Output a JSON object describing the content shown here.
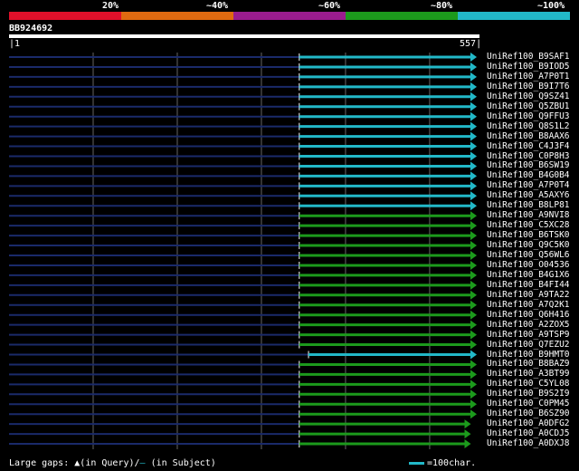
{
  "legend": {
    "segments": [
      {
        "label": "20%",
        "color": "#e0102a"
      },
      {
        "label": "~40%",
        "color": "#e06a10"
      },
      {
        "label": "~60%",
        "color": "#9a1c8e"
      },
      {
        "label": "~80%",
        "color": "#1c9a1c"
      },
      {
        "label": "~100%",
        "color": "#22b8c8"
      }
    ]
  },
  "query": {
    "id": "BB924692",
    "start": "1",
    "end": "557",
    "length": 557
  },
  "colors": {
    "gap_line": "#1a2a6a",
    "grid": "#666666",
    "hit_bar": "#ffffff"
  },
  "hits": [
    {
      "name": "UniRef100_B9SAF1",
      "from": 346,
      "to": 557,
      "color": "#22b8c8"
    },
    {
      "name": "UniRef100_B9IOD5",
      "from": 346,
      "to": 557,
      "color": "#22b8c8"
    },
    {
      "name": "UniRef100_A7P0T1",
      "from": 346,
      "to": 557,
      "color": "#22b8c8"
    },
    {
      "name": "UniRef100_B9I7T6",
      "from": 346,
      "to": 557,
      "color": "#22b8c8"
    },
    {
      "name": "UniRef100_Q9SZ41",
      "from": 346,
      "to": 557,
      "color": "#22b8c8"
    },
    {
      "name": "UniRef100_Q5ZBU1",
      "from": 346,
      "to": 557,
      "color": "#22b8c8"
    },
    {
      "name": "UniRef100_Q9FFU3",
      "from": 346,
      "to": 557,
      "color": "#22b8c8"
    },
    {
      "name": "UniRef100_Q8S1L2",
      "from": 346,
      "to": 557,
      "color": "#22b8c8"
    },
    {
      "name": "UniRef100_B8AAX6",
      "from": 346,
      "to": 557,
      "color": "#22b8c8"
    },
    {
      "name": "UniRef100_C4J3F4",
      "from": 346,
      "to": 557,
      "color": "#22b8c8"
    },
    {
      "name": "UniRef100_C0P8H3",
      "from": 346,
      "to": 557,
      "color": "#22b8c8"
    },
    {
      "name": "UniRef100_B6SW19",
      "from": 346,
      "to": 557,
      "color": "#22b8c8"
    },
    {
      "name": "UniRef100_B4G0B4",
      "from": 346,
      "to": 557,
      "color": "#22b8c8"
    },
    {
      "name": "UniRef100_A7P0T4",
      "from": 346,
      "to": 557,
      "color": "#22b8c8"
    },
    {
      "name": "UniRef100_A5AXY6",
      "from": 346,
      "to": 557,
      "color": "#22b8c8"
    },
    {
      "name": "UniRef100_B8LP81",
      "from": 346,
      "to": 557,
      "color": "#22b8c8"
    },
    {
      "name": "UniRef100_A9NVI8",
      "from": 346,
      "to": 557,
      "color": "#1c9a1c"
    },
    {
      "name": "UniRef100_C5XC28",
      "from": 346,
      "to": 557,
      "color": "#1c9a1c"
    },
    {
      "name": "UniRef100_B6TSK0",
      "from": 346,
      "to": 557,
      "color": "#1c9a1c"
    },
    {
      "name": "UniRef100_Q9C5K0",
      "from": 346,
      "to": 557,
      "color": "#1c9a1c"
    },
    {
      "name": "UniRef100_Q56WL6",
      "from": 346,
      "to": 557,
      "color": "#1c9a1c"
    },
    {
      "name": "UniRef100_O04536",
      "from": 346,
      "to": 557,
      "color": "#1c9a1c"
    },
    {
      "name": "UniRef100_B4G1X6",
      "from": 346,
      "to": 557,
      "color": "#1c9a1c"
    },
    {
      "name": "UniRef100_B4FI44",
      "from": 346,
      "to": 557,
      "color": "#1c9a1c"
    },
    {
      "name": "UniRef100_A9TA22",
      "from": 346,
      "to": 557,
      "color": "#1c9a1c"
    },
    {
      "name": "UniRef100_A7Q2K1",
      "from": 346,
      "to": 557,
      "color": "#1c9a1c"
    },
    {
      "name": "UniRef100_Q6H416",
      "from": 346,
      "to": 557,
      "color": "#1c9a1c"
    },
    {
      "name": "UniRef100_A2ZOX5",
      "from": 346,
      "to": 557,
      "color": "#1c9a1c"
    },
    {
      "name": "UniRef100_A9TSP9",
      "from": 346,
      "to": 557,
      "color": "#1c9a1c"
    },
    {
      "name": "UniRef100_Q7EZU2",
      "from": 346,
      "to": 557,
      "color": "#1c9a1c"
    },
    {
      "name": "UniRef100_B9HMT0",
      "from": 357,
      "to": 557,
      "color": "#22b8c8"
    },
    {
      "name": "UniRef100_B8BAZ9",
      "from": 346,
      "to": 557,
      "color": "#1c9a1c"
    },
    {
      "name": "UniRef100_A3BT99",
      "from": 346,
      "to": 557,
      "color": "#1c9a1c"
    },
    {
      "name": "UniRef100_C5YL08",
      "from": 346,
      "to": 557,
      "color": "#1c9a1c"
    },
    {
      "name": "UniRef100_B9S2I9",
      "from": 346,
      "to": 557,
      "color": "#1c9a1c"
    },
    {
      "name": "UniRef100_C0PM45",
      "from": 346,
      "to": 557,
      "color": "#1c9a1c"
    },
    {
      "name": "UniRef100_B6SZ90",
      "from": 346,
      "to": 557,
      "color": "#1c9a1c"
    },
    {
      "name": "UniRef100_A0DFG2",
      "from": 346,
      "to": 550,
      "color": "#1c9a1c"
    },
    {
      "name": "UniRef100_A0CDJ5",
      "from": 346,
      "to": 550,
      "color": "#1c9a1c"
    },
    {
      "name": "UniRef100_A0DXJ8",
      "from": 346,
      "to": 550,
      "color": "#1c9a1c"
    }
  ],
  "footer": {
    "large_gaps_label": "Large gaps:",
    "query_gap_symbol": "▲",
    "query_gap_text": "(in Query)/",
    "subject_gap_symbol": "–",
    "subject_gap_text": " (in Subject)",
    "scale_color": "#22b8c8",
    "scale_text": "=100char."
  }
}
